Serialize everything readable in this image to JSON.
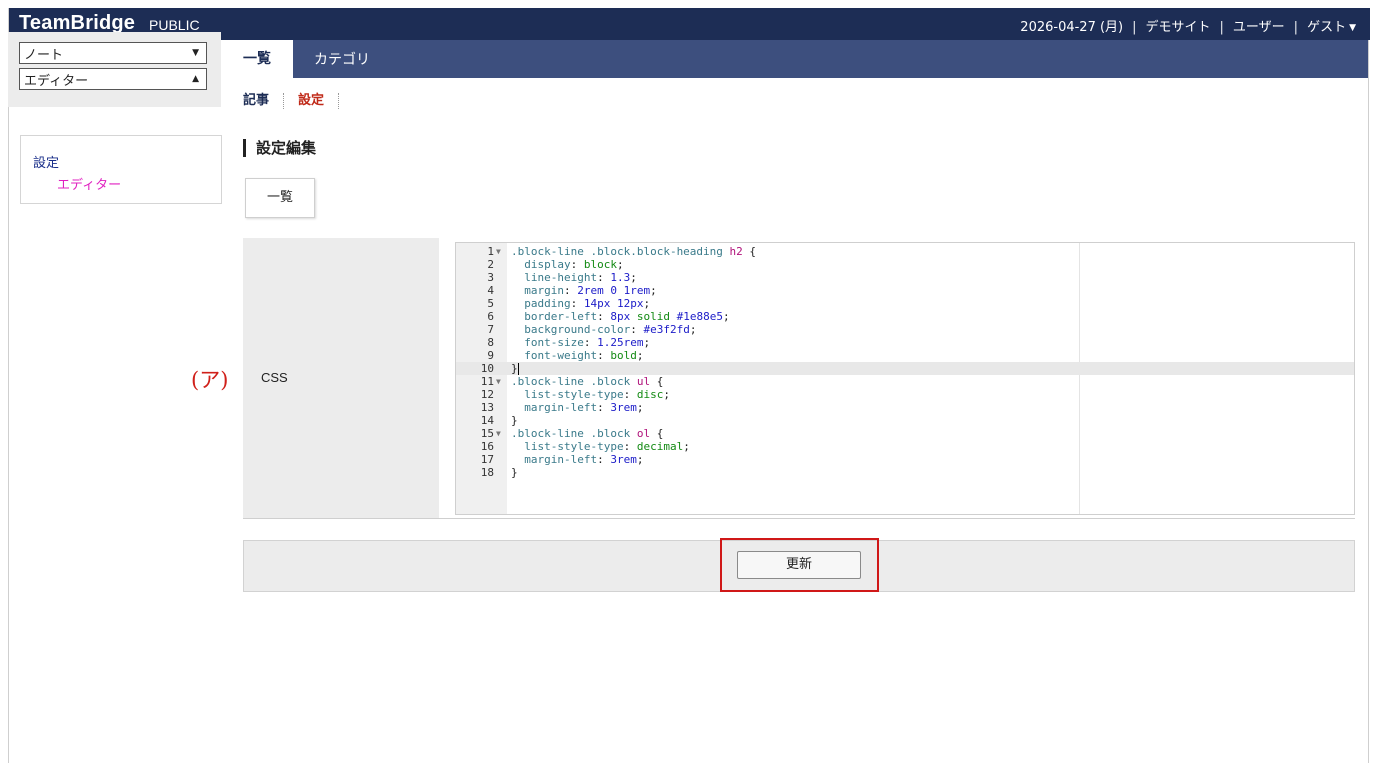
{
  "header": {
    "brand": "TeamBridge",
    "brand_sub": "PUBLIC",
    "date": "2026-04-27 (月)",
    "site": "デモサイト",
    "user_menu": "ユーザー",
    "guest": "ゲスト"
  },
  "left": {
    "select_note": "ノート",
    "select_editor": "エディター",
    "tree_parent": "設定",
    "tree_child": "エディター"
  },
  "nav": {
    "tab_list": "一覧",
    "tab_category": "カテゴリ",
    "sub_articles": "記事",
    "sub_settings": "設定"
  },
  "main": {
    "page_title": "設定編集",
    "list_button": "一覧",
    "marker": "(ア)",
    "field_label": "CSS",
    "update_button": "更新"
  },
  "editor": {
    "lines": [
      ".block-line .block.block-heading h2 {",
      "  display: block;",
      "  line-height: 1.3;",
      "  margin: 2rem 0 1rem;",
      "  padding: 14px 12px;",
      "  border-left: 8px solid #1e88e5;",
      "  background-color: #e3f2fd;",
      "  font-size: 1.25rem;",
      "  font-weight: bold;",
      "}",
      ".block-line .block ul {",
      "  list-style-type: disc;",
      "  margin-left: 3rem;",
      "}",
      ".block-line .block ol {",
      "  list-style-type: decimal;",
      "  margin-left: 3rem;",
      "}"
    ],
    "active_line": 10,
    "fold_lines": [
      1,
      11,
      15
    ]
  },
  "colors": {
    "header_bg": "#1d2d55",
    "tab_bar": "#3d4f7e",
    "highlight": "#d01818",
    "marker": "#d0201a"
  }
}
